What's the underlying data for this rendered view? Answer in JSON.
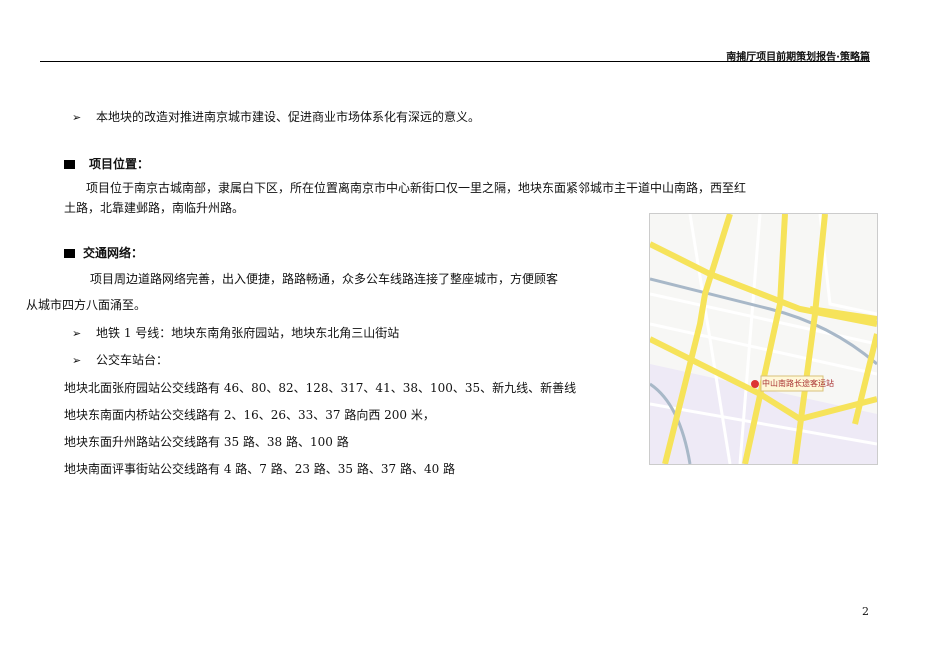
{
  "header": {
    "title": "南捕厅项目前期策划报告·策略篇"
  },
  "bullet_intro": "本地块的改造对推进南京城市建设、促进商业市场体系化有深远的意义。",
  "location": {
    "heading": "项目位置：",
    "line1": "项目位于南京古城南部，隶属白下区，所在位置离南京市中心新街口仅一里之隔，地块东面紧邻城市主干道中山南路，西至红",
    "line2": "土路，北靠建邺路，南临升州路。"
  },
  "traffic": {
    "heading": "交通网络：",
    "line1": "项目周边道路网络完善，出入便捷，路路畅通，众多公车线路连接了整座城市，方便顾客",
    "line2": "从城市四方八面涌至。",
    "metro": "地铁 1 号线：地块东南角张府园站，地块东北角三山街站",
    "bus_heading": "公交车站台：",
    "bus_lines": [
      "地块北面张府园站公交线路有 46、80、82、128、317、41、38、100、35、新九线、新善线",
      "地块东南面内桥站公交线路有 2、16、26、33、37 路向西 200 米，",
      "地块东面升州路站公交线路有 35 路、38 路、100 路",
      "地块南面评事街站公交线路有 4 路、7 路、23 路、35 路、37 路、40 路"
    ]
  },
  "map": {
    "station_label": "中山南路长途客运站",
    "marker": "5"
  },
  "page_number": "2"
}
